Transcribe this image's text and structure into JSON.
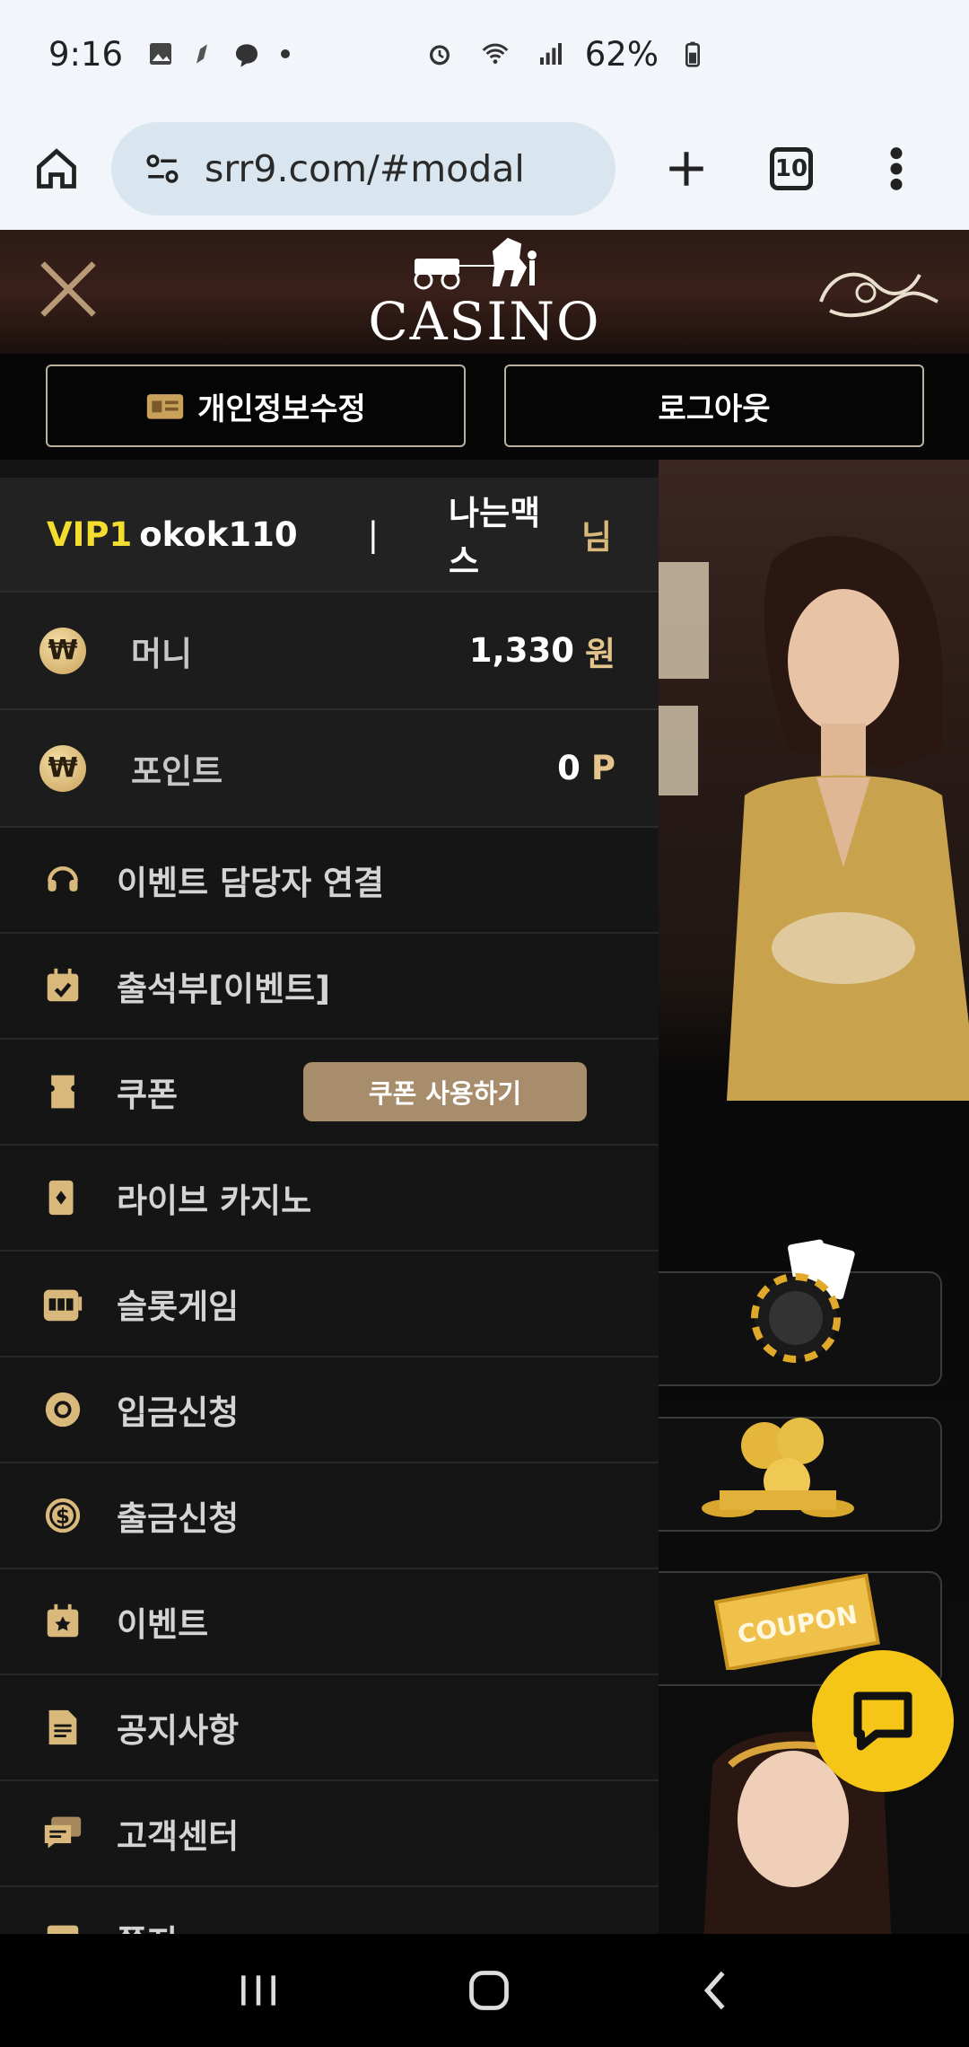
{
  "status_bar": {
    "time": "9:16",
    "battery": "62%"
  },
  "browser": {
    "url": "srr9.com/#modal",
    "tab_count": "10"
  },
  "site": {
    "logo_text": "CASINO",
    "profile_button_label": "개인정보수정",
    "logout_button_label": "로그아웃"
  },
  "drawer": {
    "user": {
      "level": "VIP1",
      "username": "okok110",
      "separator": "|",
      "nickname": "나는맥스",
      "suffix": "님"
    },
    "wallet": [
      {
        "icon": "won-coin-icon",
        "label": "머니",
        "amount": "1,330",
        "unit": "원"
      },
      {
        "icon": "won-coin-icon",
        "label": "포인트",
        "amount": "0",
        "unit": "P"
      }
    ],
    "menu": [
      {
        "icon": "headset-icon",
        "label": "이벤트 담당자 연결"
      },
      {
        "icon": "calendar-check-icon",
        "label": "출석부[이벤트]"
      },
      {
        "icon": "ticket-icon",
        "label": "쿠폰",
        "action_label": "쿠폰 사용하기"
      },
      {
        "icon": "playing-card-icon",
        "label": "라이브 카지노"
      },
      {
        "icon": "slot-machine-icon",
        "label": "슬롯게임"
      },
      {
        "icon": "chip-icon",
        "label": "입금신청"
      },
      {
        "icon": "dollar-coin-icon",
        "label": "출금신청"
      },
      {
        "icon": "calendar-star-icon",
        "label": "이벤트"
      },
      {
        "icon": "document-icon",
        "label": "공지사항"
      },
      {
        "icon": "chat-bubbles-icon",
        "label": "고객센터"
      },
      {
        "icon": "list-icon",
        "label": "쪽지"
      }
    ]
  },
  "background_cards": {
    "coupon_text": "COUPON"
  },
  "colors": {
    "accent_gold": "#d9b87c",
    "vip_yellow": "#f3dd2e",
    "chat_fab": "#f5c518",
    "coupon_button": "#a88d6c"
  }
}
